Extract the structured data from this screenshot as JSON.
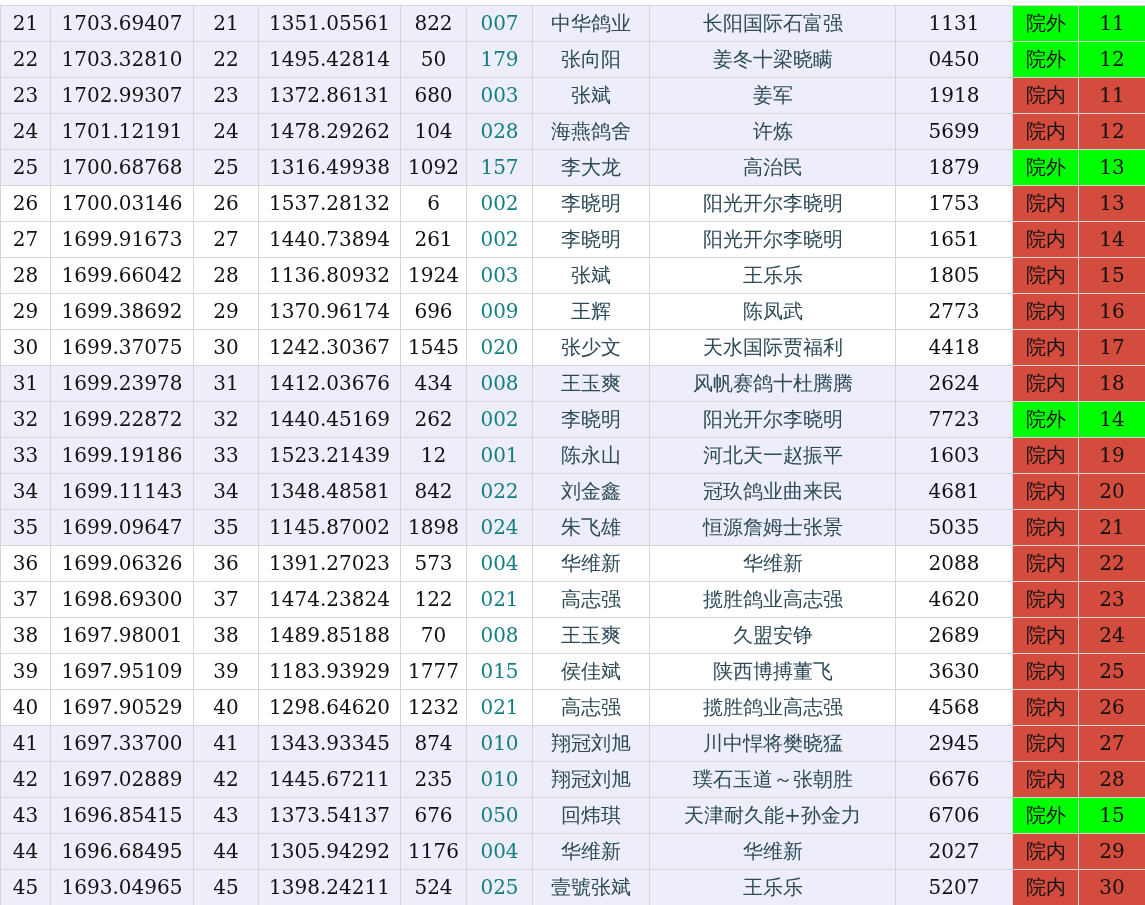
{
  "rows": [
    {
      "shaded": true,
      "cells": [
        "21",
        "1703.69407",
        "21",
        "1351.05561",
        "822",
        "007",
        "中华鸽业",
        "长阳国际石富强",
        "1131"
      ],
      "status": {
        "label": "院外",
        "color": "#00ff00"
      },
      "rank": "11"
    },
    {
      "shaded": true,
      "cells": [
        "22",
        "1703.32810",
        "22",
        "1495.42814",
        "50",
        "179",
        "张向阳",
        "姜冬十梁晓瞒",
        "0450"
      ],
      "status": {
        "label": "院外",
        "color": "#00ff00"
      },
      "rank": "12"
    },
    {
      "shaded": true,
      "cells": [
        "23",
        "1702.99307",
        "23",
        "1372.86131",
        "680",
        "003",
        "张斌",
        "姜军",
        "1918"
      ],
      "status": {
        "label": "院内",
        "color": "#d34c3d"
      },
      "rank": "11"
    },
    {
      "shaded": true,
      "cells": [
        "24",
        "1701.12191",
        "24",
        "1478.29262",
        "104",
        "028",
        "海燕鸽舍",
        "许炼",
        "5699"
      ],
      "status": {
        "label": "院内",
        "color": "#d34c3d"
      },
      "rank": "12"
    },
    {
      "shaded": true,
      "cells": [
        "25",
        "1700.68768",
        "25",
        "1316.49938",
        "1092",
        "157",
        "李大龙",
        "高治民",
        "1879"
      ],
      "status": {
        "label": "院外",
        "color": "#00ff00"
      },
      "rank": "13"
    },
    {
      "shaded": false,
      "cells": [
        "26",
        "1700.03146",
        "26",
        "1537.28132",
        "6",
        "002",
        "李晓明",
        "阳光开尔李晓明",
        "1753"
      ],
      "status": {
        "label": "院内",
        "color": "#d34c3d"
      },
      "rank": "13"
    },
    {
      "shaded": false,
      "cells": [
        "27",
        "1699.91673",
        "27",
        "1440.73894",
        "261",
        "002",
        "李晓明",
        "阳光开尔李晓明",
        "1651"
      ],
      "status": {
        "label": "院内",
        "color": "#d34c3d"
      },
      "rank": "14"
    },
    {
      "shaded": false,
      "cells": [
        "28",
        "1699.66042",
        "28",
        "1136.80932",
        "1924",
        "003",
        "张斌",
        "王乐乐",
        "1805"
      ],
      "status": {
        "label": "院内",
        "color": "#d34c3d"
      },
      "rank": "15"
    },
    {
      "shaded": false,
      "cells": [
        "29",
        "1699.38692",
        "29",
        "1370.96174",
        "696",
        "009",
        "王辉",
        "陈凤武",
        "2773"
      ],
      "status": {
        "label": "院内",
        "color": "#d34c3d"
      },
      "rank": "16"
    },
    {
      "shaded": false,
      "cells": [
        "30",
        "1699.37075",
        "30",
        "1242.30367",
        "1545",
        "020",
        "张少文",
        "天水国际贾福利",
        "4418"
      ],
      "status": {
        "label": "院内",
        "color": "#d34c3d"
      },
      "rank": "17"
    },
    {
      "shaded": true,
      "cells": [
        "31",
        "1699.23978",
        "31",
        "1412.03676",
        "434",
        "008",
        "王玉爽",
        "风帆赛鸽十杜腾腾",
        "2624"
      ],
      "status": {
        "label": "院内",
        "color": "#d34c3d"
      },
      "rank": "18"
    },
    {
      "shaded": true,
      "cells": [
        "32",
        "1699.22872",
        "32",
        "1440.45169",
        "262",
        "002",
        "李晓明",
        "阳光开尔李晓明",
        "7723"
      ],
      "status": {
        "label": "院外",
        "color": "#00ff00"
      },
      "rank": "14"
    },
    {
      "shaded": true,
      "cells": [
        "33",
        "1699.19186",
        "33",
        "1523.21439",
        "12",
        "001",
        "陈永山",
        "河北天一赵振平",
        "1603"
      ],
      "status": {
        "label": "院内",
        "color": "#d34c3d"
      },
      "rank": "19"
    },
    {
      "shaded": true,
      "cells": [
        "34",
        "1699.11143",
        "34",
        "1348.48581",
        "842",
        "022",
        "刘金鑫",
        "冠玖鸽业曲来民",
        "4681"
      ],
      "status": {
        "label": "院内",
        "color": "#d34c3d"
      },
      "rank": "20"
    },
    {
      "shaded": true,
      "cells": [
        "35",
        "1699.09647",
        "35",
        "1145.87002",
        "1898",
        "024",
        "朱飞雄",
        "恒源詹姆士张景",
        "5035"
      ],
      "status": {
        "label": "院内",
        "color": "#d34c3d"
      },
      "rank": "21"
    },
    {
      "shaded": false,
      "cells": [
        "36",
        "1699.06326",
        "36",
        "1391.27023",
        "573",
        "004",
        "华维新",
        "华维新",
        "2088"
      ],
      "status": {
        "label": "院内",
        "color": "#d34c3d"
      },
      "rank": "22"
    },
    {
      "shaded": false,
      "cells": [
        "37",
        "1698.69300",
        "37",
        "1474.23824",
        "122",
        "021",
        "高志强",
        "揽胜鸽业高志强",
        "4620"
      ],
      "status": {
        "label": "院内",
        "color": "#d34c3d"
      },
      "rank": "23"
    },
    {
      "shaded": false,
      "cells": [
        "38",
        "1697.98001",
        "38",
        "1489.85188",
        "70",
        "008",
        "王玉爽",
        "久盟安铮",
        "2689"
      ],
      "status": {
        "label": "院内",
        "color": "#d34c3d"
      },
      "rank": "24"
    },
    {
      "shaded": false,
      "cells": [
        "39",
        "1697.95109",
        "39",
        "1183.93929",
        "1777",
        "015",
        "侯佳斌",
        "陕西博搏董飞",
        "3630"
      ],
      "status": {
        "label": "院内",
        "color": "#d34c3d"
      },
      "rank": "25"
    },
    {
      "shaded": false,
      "cells": [
        "40",
        "1697.90529",
        "40",
        "1298.64620",
        "1232",
        "021",
        "高志强",
        "揽胜鸽业高志强",
        "4568"
      ],
      "status": {
        "label": "院内",
        "color": "#d34c3d"
      },
      "rank": "26"
    },
    {
      "shaded": true,
      "cells": [
        "41",
        "1697.33700",
        "41",
        "1343.93345",
        "874",
        "010",
        "翔冠刘旭",
        "川中悍将樊晓猛",
        "2945"
      ],
      "status": {
        "label": "院内",
        "color": "#d34c3d"
      },
      "rank": "27"
    },
    {
      "shaded": true,
      "cells": [
        "42",
        "1697.02889",
        "42",
        "1445.67211",
        "235",
        "010",
        "翔冠刘旭",
        "璞石玉道～张朝胜",
        "6676"
      ],
      "status": {
        "label": "院内",
        "color": "#d34c3d"
      },
      "rank": "28"
    },
    {
      "shaded": true,
      "cells": [
        "43",
        "1696.85415",
        "43",
        "1373.54137",
        "676",
        "050",
        "回炜琪",
        "天津耐久能+孙金力",
        "6706"
      ],
      "status": {
        "label": "院外",
        "color": "#00ff00"
      },
      "rank": "15"
    },
    {
      "shaded": true,
      "cells": [
        "44",
        "1696.68495",
        "44",
        "1305.94292",
        "1176",
        "004",
        "华维新",
        "华维新",
        "2027"
      ],
      "status": {
        "label": "院内",
        "color": "#d34c3d"
      },
      "rank": "29"
    },
    {
      "shaded": true,
      "cells": [
        "45",
        "1693.04965",
        "45",
        "1398.24211",
        "524",
        "025",
        "壹號张斌",
        "王乐乐",
        "5207"
      ],
      "status": {
        "label": "院内",
        "color": "#d34c3d"
      },
      "rank": "30"
    }
  ]
}
